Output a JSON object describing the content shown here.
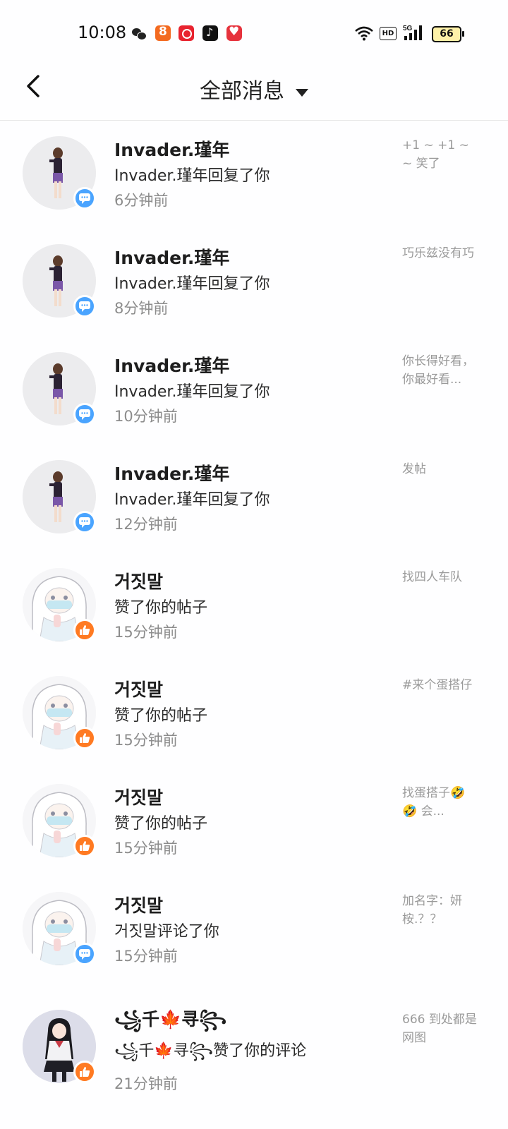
{
  "status_bar": {
    "time": "10:08",
    "network": "5G",
    "battery": "66",
    "hd_label": "HD"
  },
  "header": {
    "title": "全部消息"
  },
  "messages": [
    {
      "name": "Invader.瑾年",
      "action": "Invader.瑾年回复了你",
      "time_ago": "6分钟前",
      "snippet": "+1 ~ +1 ~ ~ 笑了",
      "type": "reply"
    },
    {
      "name": "Invader.瑾年",
      "action": "Invader.瑾年回复了你",
      "time_ago": "8分钟前",
      "snippet": "巧乐兹没有巧",
      "type": "reply"
    },
    {
      "name": "Invader.瑾年",
      "action": "Invader.瑾年回复了你",
      "time_ago": "10分钟前",
      "snippet": "你长得好看，你最好看...",
      "type": "reply"
    },
    {
      "name": "Invader.瑾年",
      "action": "Invader.瑾年回复了你",
      "time_ago": "12分钟前",
      "snippet": "发帖",
      "type": "reply"
    },
    {
      "name": "거짓말",
      "action": "赞了你的帖子",
      "time_ago": "15分钟前",
      "snippet": "找四人车队",
      "type": "like"
    },
    {
      "name": "거짓말",
      "action": "赞了你的帖子",
      "time_ago": "15分钟前",
      "snippet": "#来个蛋搭仔",
      "type": "like"
    },
    {
      "name": "거짓말",
      "action": "赞了你的帖子",
      "time_ago": "15分钟前",
      "snippet": "找蛋搭子🤣🤣 会...",
      "type": "like"
    },
    {
      "name": "거짓말",
      "action": "거짓말评论了你",
      "time_ago": "15分钟前",
      "snippet": "加名字：妍桉.？？",
      "type": "reply"
    },
    {
      "name": "꧁千🍁寻꧂",
      "action": "꧁千🍁寻꧂赞了你的评论",
      "time_ago": "21分钟前",
      "snippet": "666 到处都是网图",
      "type": "like"
    }
  ]
}
